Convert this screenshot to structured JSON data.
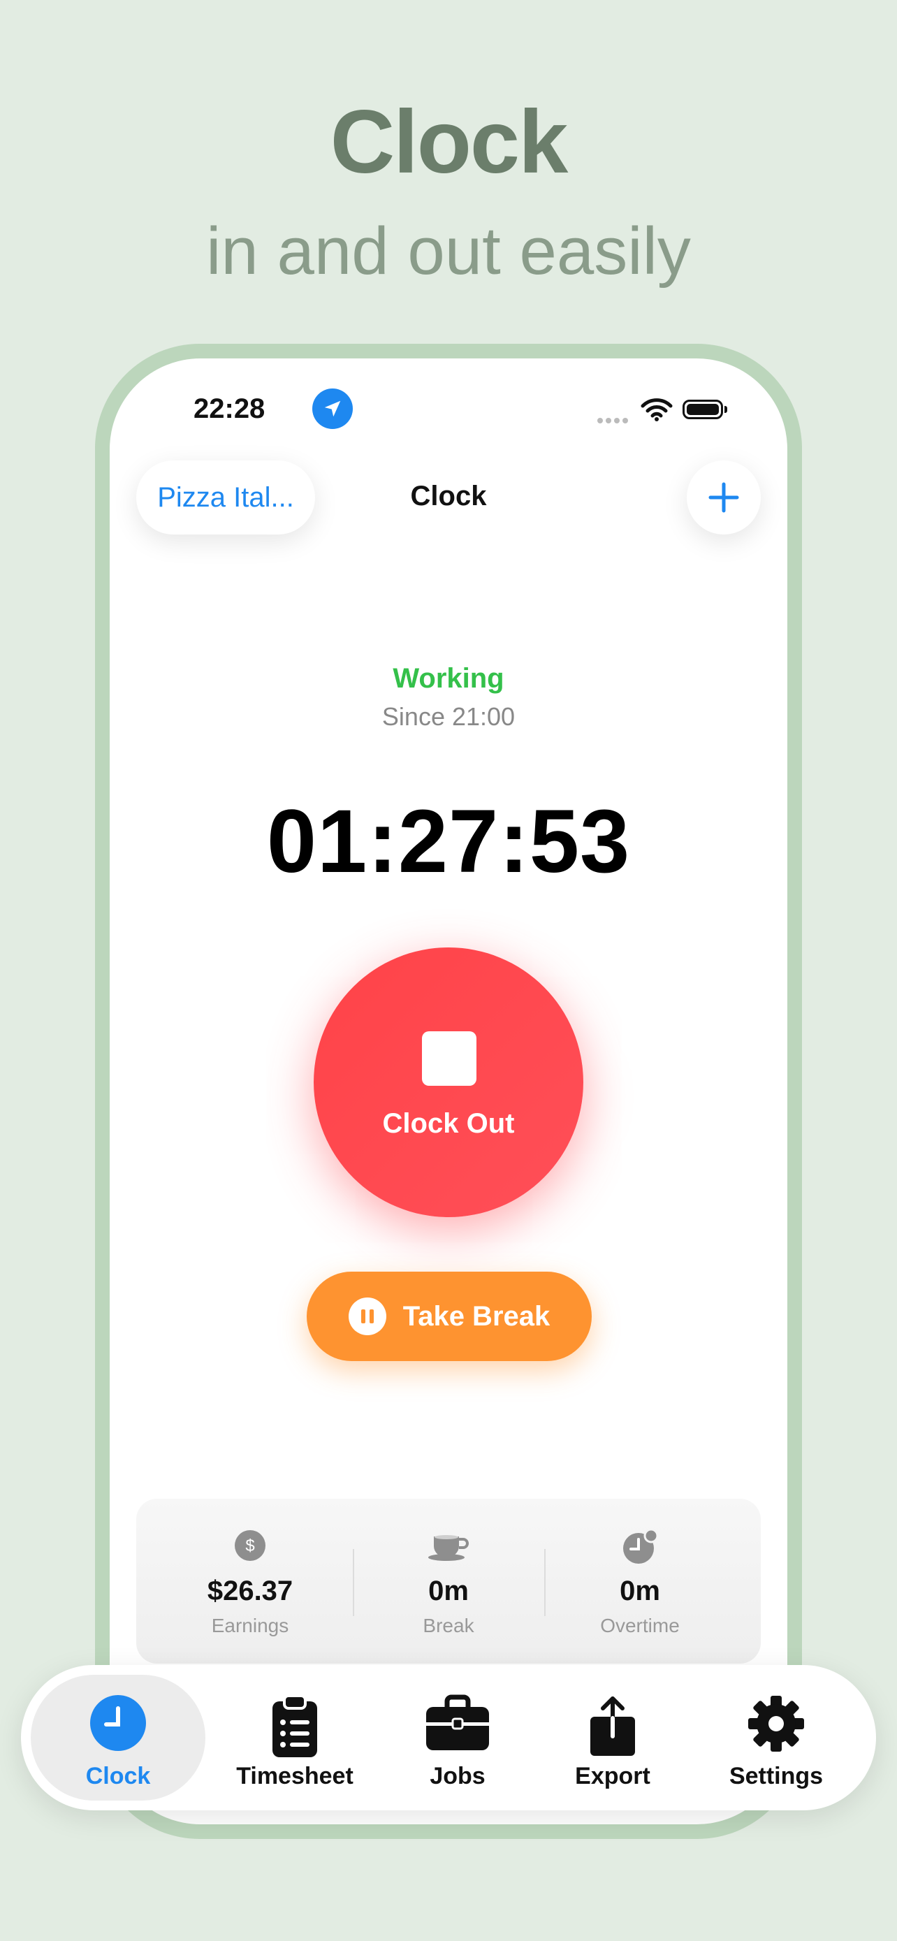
{
  "hero": {
    "title": "Clock",
    "subtitle": "in and out easily"
  },
  "status_bar": {
    "time": "22:28",
    "location_icon": "location-arrow-icon",
    "wifi_icon": "wifi-icon",
    "battery_icon": "battery-icon"
  },
  "nav": {
    "job_label": "Pizza Ital...",
    "title": "Clock",
    "add_icon": "plus-icon"
  },
  "session": {
    "status": "Working",
    "since": "Since 21:00",
    "timer": "01:27:53"
  },
  "actions": {
    "clock_out_label": "Clock Out",
    "break_label": "Take Break"
  },
  "stats": [
    {
      "icon": "dollar-icon",
      "value": "$26.37",
      "label": "Earnings"
    },
    {
      "icon": "coffee-cup-icon",
      "value": "0m",
      "label": "Break"
    },
    {
      "icon": "overtime-clock-icon",
      "value": "0m",
      "label": "Overtime"
    }
  ],
  "tabs": [
    {
      "icon": "clock-icon",
      "label": "Clock",
      "active": true
    },
    {
      "icon": "clipboard-list-icon",
      "label": "Timesheet",
      "active": false
    },
    {
      "icon": "briefcase-icon",
      "label": "Jobs",
      "active": false
    },
    {
      "icon": "share-export-icon",
      "label": "Export",
      "active": false
    },
    {
      "icon": "gear-icon",
      "label": "Settings",
      "active": false
    }
  ],
  "colors": {
    "background": "#e2ece2",
    "accent_blue": "#1e88f0",
    "working_green": "#34c04a",
    "clock_out_red": "#ff4348",
    "break_orange": "#fe9330",
    "frame_green": "#bcd6bc"
  }
}
